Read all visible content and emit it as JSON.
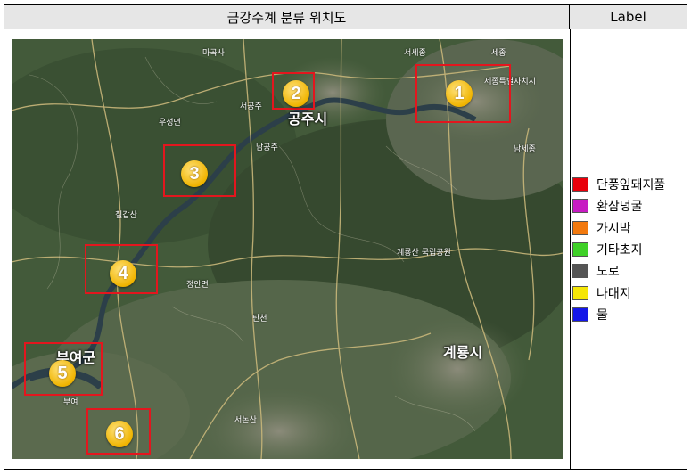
{
  "header": {
    "title": "금강수계 분류 위치도",
    "label_column": "Label"
  },
  "map": {
    "cities": {
      "gongju": "공주시",
      "gyeryong": "계룡시",
      "buyeo": "부여군"
    },
    "places": [
      "마곡사",
      "서세종",
      "세종",
      "세종특별자치시",
      "남세종",
      "우성면",
      "서공주",
      "남공주",
      "칠갑산",
      "탄천",
      "계룡산 국립공원",
      "서논산",
      "정안면",
      "부여"
    ],
    "roi_markers": [
      "1",
      "2",
      "3",
      "4",
      "5",
      "6"
    ],
    "roi_color": "#e3161e",
    "marker_color": "#f0b400"
  },
  "legend": {
    "items": [
      {
        "label": "단풍잎돼지풀",
        "color": "#e8000b"
      },
      {
        "label": "환삼덩굴",
        "color": "#c71bc2"
      },
      {
        "label": "가시박",
        "color": "#f2790f"
      },
      {
        "label": "기타초지",
        "color": "#3fd128"
      },
      {
        "label": "도로",
        "color": "#555555"
      },
      {
        "label": "나대지",
        "color": "#f5e607"
      },
      {
        "label": "물",
        "color": "#1417e8"
      }
    ]
  }
}
